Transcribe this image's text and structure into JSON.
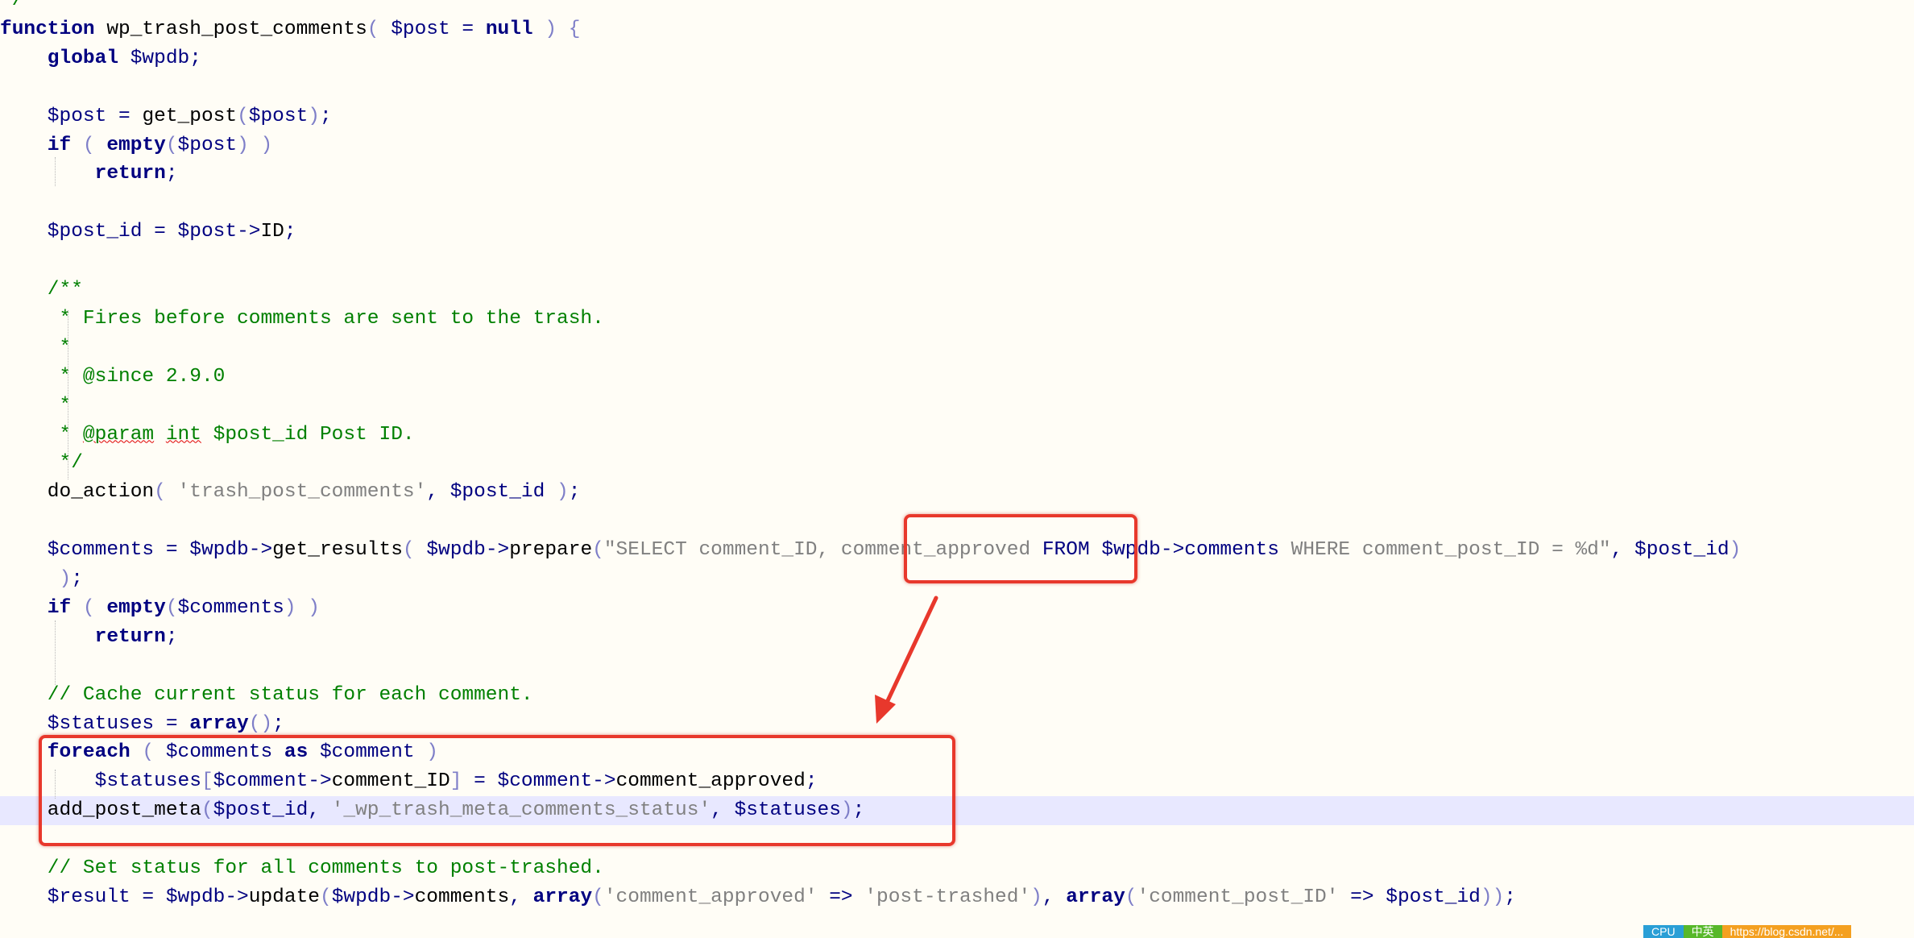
{
  "code": {
    "lines": [
      [
        [
          "t-com",
          "*/"
        ]
      ],
      [
        [
          "t-kw",
          "function"
        ],
        [
          "t-id",
          " wp_trash_post_comments"
        ],
        [
          "t-paren",
          "( "
        ],
        [
          "t-var",
          "$post"
        ],
        [
          "t-op",
          " = "
        ],
        [
          "t-kw",
          "null"
        ],
        [
          "t-paren",
          " ) {"
        ]
      ],
      [
        [
          "t-kw",
          "    global"
        ],
        [
          "t-var",
          " $wpdb"
        ],
        [
          "t-op",
          ";"
        ]
      ],
      [],
      [
        [
          "t-var",
          "    $post"
        ],
        [
          "t-op",
          " = "
        ],
        [
          "t-id",
          "get_post"
        ],
        [
          "t-paren",
          "("
        ],
        [
          "t-var",
          "$post"
        ],
        [
          "t-paren",
          ")"
        ],
        [
          "t-op",
          ";"
        ]
      ],
      [
        [
          "t-kw",
          "    if"
        ],
        [
          "t-paren",
          " ( "
        ],
        [
          "t-kw",
          "empty"
        ],
        [
          "t-paren",
          "("
        ],
        [
          "t-var",
          "$post"
        ],
        [
          "t-paren",
          ") )"
        ]
      ],
      [
        [
          "t-kw",
          "        return"
        ],
        [
          "t-op",
          ";"
        ]
      ],
      [],
      [
        [
          "t-var",
          "    $post_id"
        ],
        [
          "t-op",
          " = "
        ],
        [
          "t-var",
          "$post"
        ],
        [
          "t-op",
          "->"
        ],
        [
          "t-id",
          "ID"
        ],
        [
          "t-op",
          ";"
        ]
      ],
      [],
      [
        [
          "t-com",
          "    /**"
        ]
      ],
      [
        [
          "t-com",
          "     * Fires before comments are sent to the trash."
        ]
      ],
      [
        [
          "t-com",
          "     *"
        ]
      ],
      [
        [
          "t-com",
          "     * @since 2.9.0"
        ]
      ],
      [
        [
          "t-com",
          "     *"
        ]
      ],
      [
        [
          "t-com",
          "     * "
        ],
        [
          "t-com t-spell",
          "@param"
        ],
        [
          "t-com",
          " "
        ],
        [
          "t-com t-spell",
          "int"
        ],
        [
          "t-com",
          " $post_id Post ID."
        ]
      ],
      [
        [
          "t-com",
          "     */"
        ]
      ],
      [
        [
          "t-id",
          "    do_action"
        ],
        [
          "t-paren",
          "( "
        ],
        [
          "t-str",
          "'trash_post_comments'"
        ],
        [
          "t-op",
          ", "
        ],
        [
          "t-var",
          "$post_id"
        ],
        [
          "t-paren",
          " )"
        ],
        [
          "t-op",
          ";"
        ]
      ],
      [],
      [
        [
          "t-var",
          "    $comments"
        ],
        [
          "t-op",
          " = "
        ],
        [
          "t-var",
          "$wpdb"
        ],
        [
          "t-op",
          "->"
        ],
        [
          "t-id",
          "get_results"
        ],
        [
          "t-paren",
          "( "
        ],
        [
          "t-var",
          "$wpdb"
        ],
        [
          "t-op",
          "->"
        ],
        [
          "t-id",
          "prepare"
        ],
        [
          "t-paren",
          "("
        ],
        [
          "t-str",
          "\"SELECT comment_ID, comment_approved "
        ],
        [
          "t-var",
          "FROM $wpdb->comments"
        ],
        [
          "t-str",
          " WHERE comment_post_ID = %d\""
        ],
        [
          "t-op",
          ", "
        ],
        [
          "t-var",
          "$post_id"
        ],
        [
          "t-paren",
          ")"
        ]
      ],
      [
        [
          "t-paren",
          "     )"
        ],
        [
          "t-op",
          ";"
        ]
      ],
      [
        [
          "t-kw",
          "    if"
        ],
        [
          "t-paren",
          " ( "
        ],
        [
          "t-kw",
          "empty"
        ],
        [
          "t-paren",
          "("
        ],
        [
          "t-var",
          "$comments"
        ],
        [
          "t-paren",
          ") )"
        ]
      ],
      [
        [
          "t-kw",
          "        return"
        ],
        [
          "t-op",
          ";"
        ]
      ],
      [],
      [
        [
          "t-com",
          "    // Cache current status for each comment."
        ]
      ],
      [
        [
          "t-var",
          "    $statuses"
        ],
        [
          "t-op",
          " = "
        ],
        [
          "t-kw",
          "array"
        ],
        [
          "t-paren",
          "()"
        ],
        [
          "t-op",
          ";"
        ]
      ],
      [
        [
          "t-kw",
          "    foreach"
        ],
        [
          "t-paren",
          " ( "
        ],
        [
          "t-var",
          "$comments"
        ],
        [
          "t-kw",
          " as"
        ],
        [
          "t-var",
          " $comment"
        ],
        [
          "t-paren",
          " )"
        ]
      ],
      [
        [
          "t-var",
          "        $statuses"
        ],
        [
          "t-paren",
          "["
        ],
        [
          "t-var",
          "$comment"
        ],
        [
          "t-op",
          "->"
        ],
        [
          "t-id",
          "comment_ID"
        ],
        [
          "t-paren",
          "]"
        ],
        [
          "t-op",
          " = "
        ],
        [
          "t-var",
          "$comment"
        ],
        [
          "t-op",
          "->"
        ],
        [
          "t-id",
          "comment_approved"
        ],
        [
          "t-op",
          ";"
        ]
      ],
      [
        [
          "t-id",
          "    add_post_meta"
        ],
        [
          "t-paren",
          "("
        ],
        [
          "t-var",
          "$post_id"
        ],
        [
          "t-op",
          ", "
        ],
        [
          "t-str",
          "'_wp_trash_meta_comments_status'"
        ],
        [
          "t-op",
          ", "
        ],
        [
          "t-var",
          "$statuses"
        ],
        [
          "t-paren",
          ")"
        ],
        [
          "t-op",
          ";"
        ]
      ],
      [],
      [
        [
          "t-com",
          "    // Set status for all comments to post-trashed."
        ]
      ],
      [
        [
          "t-var",
          "    $result"
        ],
        [
          "t-op",
          " = "
        ],
        [
          "t-var",
          "$wpdb"
        ],
        [
          "t-op",
          "->"
        ],
        [
          "t-id",
          "update"
        ],
        [
          "t-paren",
          "("
        ],
        [
          "t-var",
          "$wpdb"
        ],
        [
          "t-op",
          "->"
        ],
        [
          "t-id",
          "comments"
        ],
        [
          "t-op",
          ", "
        ],
        [
          "t-kw",
          "array"
        ],
        [
          "t-paren",
          "("
        ],
        [
          "t-str",
          "'comment_approved'"
        ],
        [
          "t-op",
          " => "
        ],
        [
          "t-str",
          "'post-trashed'"
        ],
        [
          "t-paren",
          ")"
        ],
        [
          "t-op",
          ", "
        ],
        [
          "t-kw",
          "array"
        ],
        [
          "t-paren",
          "("
        ],
        [
          "t-str",
          "'comment_post_ID'"
        ],
        [
          "t-op",
          " => "
        ],
        [
          "t-var",
          "$post_id"
        ],
        [
          "t-paren",
          "))"
        ],
        [
          "t-op",
          ";"
        ]
      ]
    ]
  },
  "statusbar": {
    "items": [
      {
        "label": "CPU",
        "color": "#2a9fd6"
      },
      {
        "label": "中英",
        "color": "#57b82a"
      },
      {
        "label": "https://blog.csdn.net/...",
        "color": "#f4a020"
      }
    ]
  },
  "colors": {
    "background": "#fffdf6",
    "highlight_line": "#e8e8ff",
    "callout_red": "#e8382c"
  }
}
